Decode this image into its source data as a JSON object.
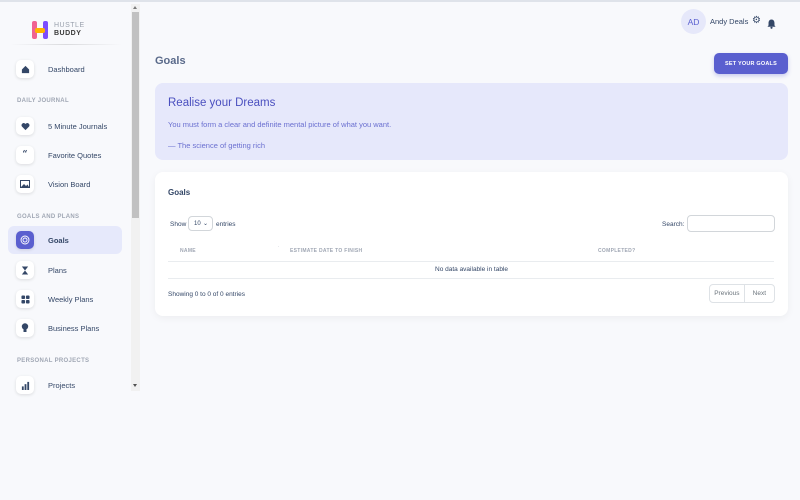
{
  "brand": {
    "line1": "HUSTLE",
    "line2": "BUDDY"
  },
  "sidebar": {
    "items": [
      {
        "label": "Dashboard",
        "icon": "home-icon"
      },
      {
        "label": "5 Minute Journals",
        "icon": "heart-icon"
      },
      {
        "label": "Favorite Quotes",
        "icon": "quote-icon"
      },
      {
        "label": "Vision Board",
        "icon": "image-icon"
      },
      {
        "label": "Goals",
        "icon": "target-icon",
        "active": true
      },
      {
        "label": "Plans",
        "icon": "hourglass-icon"
      },
      {
        "label": "Weekly Plans",
        "icon": "grid-icon"
      },
      {
        "label": "Business Plans",
        "icon": "lightbulb-icon"
      },
      {
        "label": "Projects",
        "icon": "bar-chart-icon"
      }
    ],
    "sections": {
      "daily": "DAILY JOURNAL",
      "goals": "GOALS AND PLANS",
      "personal": "PERSONAL PROJECTS"
    }
  },
  "user": {
    "initials": "AD",
    "name": "Andy Deals"
  },
  "page": {
    "title": "Goals",
    "set_goals_button": "SET YOUR GOALS"
  },
  "dream": {
    "title": "Realise your Dreams",
    "text": "You must form a clear and definite mental picture of what you want.",
    "source": "— The science of getting rich"
  },
  "goals_table": {
    "title": "Goals",
    "show_label": "Show",
    "entries_value": "10",
    "entries_label": "entries",
    "search_label": "Search:",
    "search_value": "",
    "columns": [
      "NAME",
      "ESTIMATE DATE TO FINISH",
      "COMPLETED?"
    ],
    "empty_message": "No data available in table",
    "showing_text": "Showing 0 to 0 of 0 entries",
    "prev_label": "Previous",
    "next_label": "Next"
  },
  "colors": {
    "accent": "#5a5fcf",
    "dream_bg": "#e6e8fb",
    "active_nav_bg": "#e6e9fb"
  }
}
